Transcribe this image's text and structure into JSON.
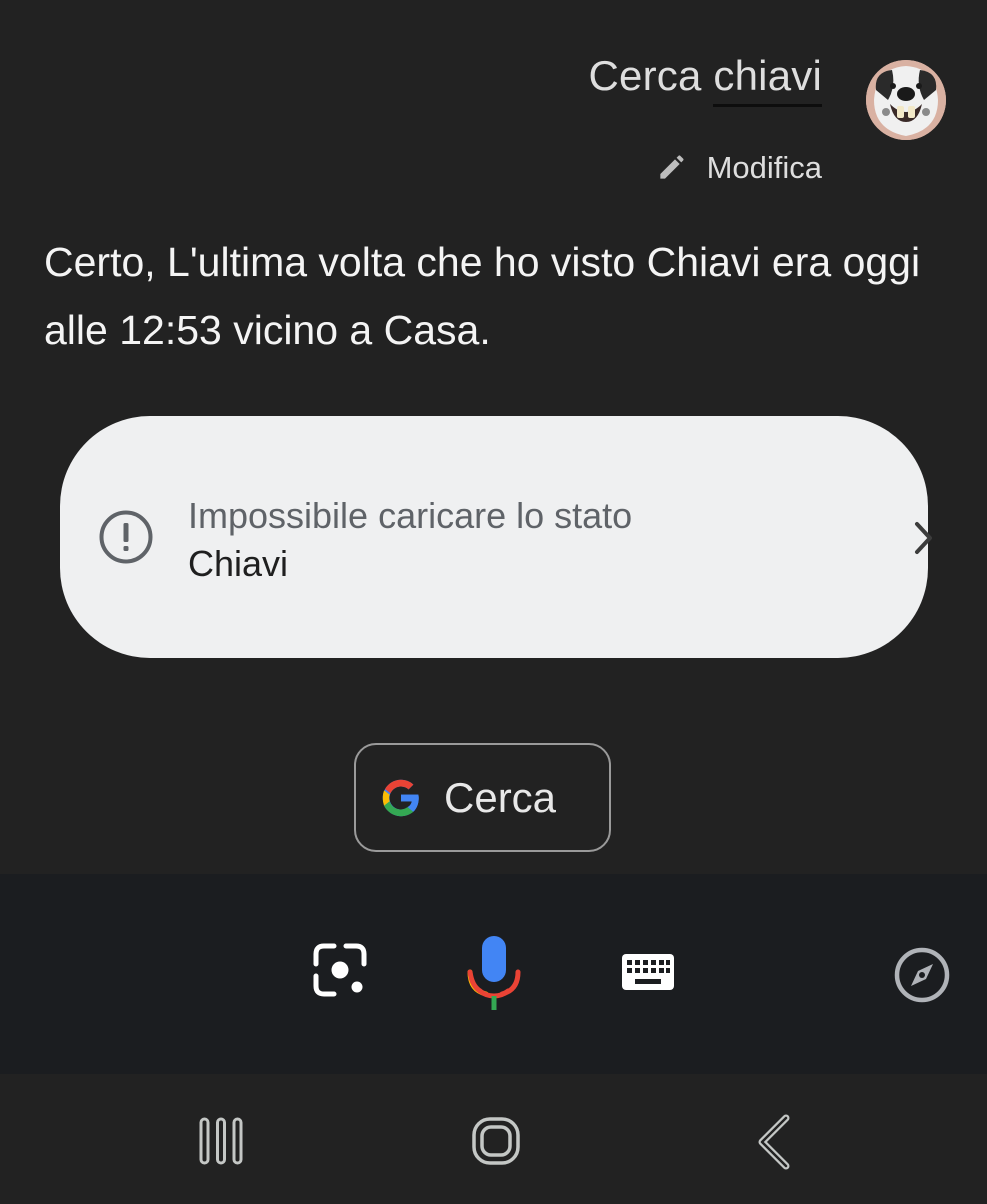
{
  "query": {
    "text_before": "Cerca ",
    "text_keyword": "chiavi"
  },
  "edit": {
    "label": "Modifica",
    "icon": "pencil-icon"
  },
  "answer": {
    "text": "Certo, L'ultima volta che ho visto Chiavi era oggi alle 12:53 vicino a Casa."
  },
  "error_card": {
    "title": "Impossibile caricare lo stato",
    "subtitle": "Chiavi",
    "icon": "alert-circle-icon"
  },
  "search_chip": {
    "label": "Cerca",
    "icon": "google-g-icon"
  },
  "toolbar": {
    "icons": [
      "lens-icon",
      "microphone-icon",
      "keyboard-icon",
      "compass-icon"
    ]
  },
  "navbar": {
    "icons": [
      "recents-icon",
      "home-icon",
      "back-icon"
    ]
  },
  "colors": {
    "background": "#222222",
    "toolbar_background": "#1b1d20",
    "card_background": "#eff0f1",
    "google_blue": "#4285f4",
    "google_red": "#ea4335",
    "google_yellow": "#fbbc05",
    "google_green": "#34a853"
  }
}
